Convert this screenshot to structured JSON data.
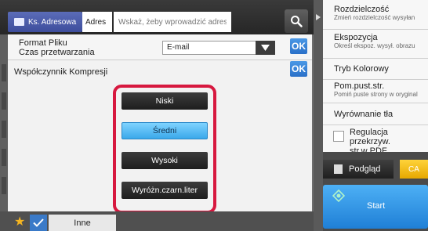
{
  "address_bar": {
    "address_book_label": "Ks. Adresowa",
    "address_label": "Adres",
    "address_placeholder": "Wskaż, żeby wprowadzić adres"
  },
  "format_panel": {
    "label_line1": "Format Pliku",
    "label_line2": "Czas przetwarzania",
    "selected_value": "E-mail",
    "ok_label": "OK"
  },
  "compression_dialog": {
    "title": "Współczynnik Kompresji",
    "ok_label": "OK",
    "options": [
      "Niski",
      "Średni",
      "Wysoki",
      "Wyróżn.czarn.liter"
    ],
    "selected": "Średni"
  },
  "right_panel": {
    "items": [
      {
        "title": "Rozdzielczość",
        "subtitle": "Zmień rozdzielczość wysyłan"
      },
      {
        "title": "Ekspozycja",
        "subtitle": "Określ ekspoz. wysył. obrazu"
      },
      {
        "title": "Tryb Kolorowy",
        "subtitle": ""
      },
      {
        "title": "Pom.pust.str.",
        "subtitle": "Pomiń puste strony w oryginal"
      },
      {
        "title": "Wyrównanie tła",
        "subtitle": ""
      }
    ],
    "regulation_line1": "Regulacja przekrzyw.",
    "regulation_line2": "str.w PDF"
  },
  "bottom_bar": {
    "other_label": "Inne"
  },
  "actions": {
    "preview_label": "Podgląd",
    "ca_label": "CA",
    "start_label": "Start"
  },
  "colors": {
    "accent_blue": "#2a70c8",
    "highlight_red": "#d7183f",
    "selected_option": "#3aa8ea",
    "ca_yellow": "#e6a800",
    "start_blue": "#1f7fd6"
  }
}
